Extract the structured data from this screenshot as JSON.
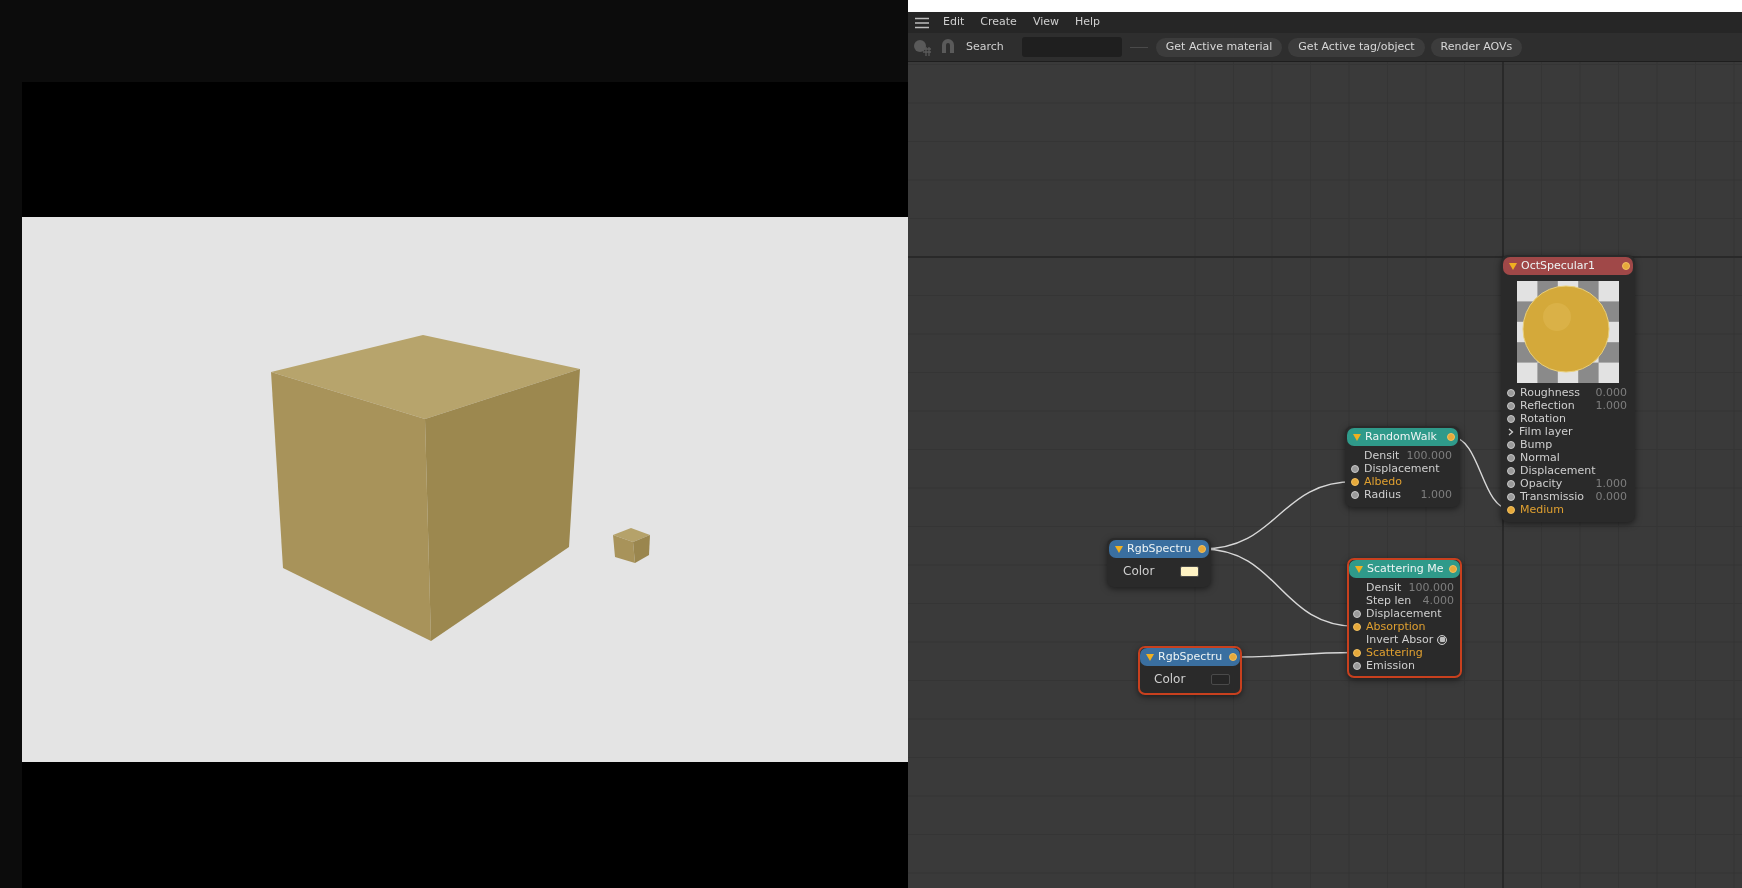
{
  "menu": [
    "Edit",
    "Create",
    "View",
    "Help"
  ],
  "toolbar": {
    "search_label": "Search",
    "buttons": [
      "Get Active material",
      "Get Active tag/object",
      "Render AOVs"
    ]
  },
  "nodes": [
    {
      "kind": "material",
      "title": "OctSpecular1",
      "color": "#a04848",
      "selected": false,
      "ports": [
        {
          "kind": "pin",
          "label": "Roughness",
          "value": "0.000",
          "linked": false
        },
        {
          "kind": "pin",
          "label": "Reflection",
          "value": "1.000",
          "linked": false
        },
        {
          "kind": "pin",
          "label": "Rotation",
          "linked": false
        },
        {
          "kind": "group",
          "label": "Film layer"
        },
        {
          "kind": "pin",
          "label": "Bump",
          "linked": false
        },
        {
          "kind": "pin",
          "label": "Normal",
          "linked": false
        },
        {
          "kind": "pin",
          "label": "Displacement",
          "linked": false
        },
        {
          "kind": "pin",
          "label": "Opacity",
          "value": "1.000",
          "linked": false
        },
        {
          "kind": "pin",
          "label": "Transmissio",
          "value": "0.000",
          "linked": false
        },
        {
          "kind": "pin",
          "label": "Medium",
          "linked": true
        }
      ]
    },
    {
      "kind": "medium",
      "title": "RandomWalk",
      "color": "#2f9a8a",
      "selected": false,
      "ports": [
        {
          "kind": "none",
          "label": "Densit",
          "value": "100.000"
        },
        {
          "kind": "pin",
          "label": "Displacement",
          "linked": false
        },
        {
          "kind": "pin",
          "label": "Albedo",
          "linked": true
        },
        {
          "kind": "pin",
          "label": "Radius",
          "value": "1.000",
          "linked": false
        }
      ]
    },
    {
      "kind": "medium",
      "title": "Scattering Me",
      "color": "#2f9a8a",
      "selected": true,
      "ports": [
        {
          "kind": "none",
          "label": "Densit",
          "value": "100.000"
        },
        {
          "kind": "none",
          "label": "Step len",
          "value": "4.000"
        },
        {
          "kind": "pin",
          "label": "Displacement",
          "linked": false
        },
        {
          "kind": "pin",
          "label": "Absorption",
          "linked": true
        },
        {
          "kind": "toggle",
          "label": "Invert Absor",
          "checked": false
        },
        {
          "kind": "pin",
          "label": "Scattering",
          "linked": true
        },
        {
          "kind": "pin",
          "label": "Emission",
          "linked": false
        }
      ]
    },
    {
      "kind": "texture",
      "title": "RgbSpectru",
      "color": "#3a6fa0",
      "selected": false,
      "ports": [
        {
          "kind": "swatch",
          "label": "Color",
          "color": "#fff3c4"
        }
      ]
    },
    {
      "kind": "texture",
      "title": "RgbSpectru",
      "color": "#3a6fa0",
      "selected": true,
      "ports": [
        {
          "kind": "swatch",
          "label": "Color",
          "color": "#262626"
        }
      ]
    }
  ]
}
